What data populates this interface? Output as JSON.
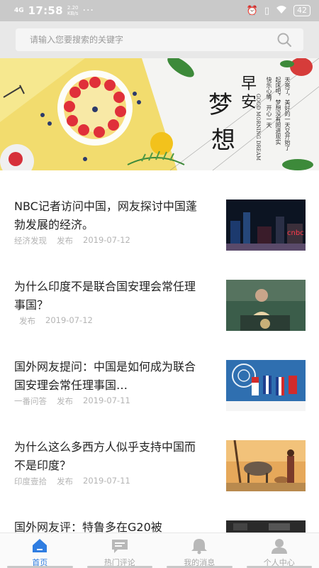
{
  "status_bar": {
    "network": "4G",
    "time": "17:58",
    "speed_value": "2.20",
    "speed_unit": "KB/s",
    "more": "···",
    "battery": "42"
  },
  "search": {
    "placeholder": "请输入您要搜索的关键字"
  },
  "banner": {
    "title_chars": [
      "早",
      "安",
      "梦",
      "想"
    ],
    "english": "GOOD MORNING DREAM",
    "vertical_text": [
      "天亮了，美好的一天又开始了",
      "起床吧，梦想没有照进现实",
      "快乐心情，开心一天"
    ]
  },
  "news": [
    {
      "title": "NBC记者访问中国，网友探讨中国蓬勃发展的经济。",
      "source": "经济发现",
      "publish": "发布",
      "date": "2019-07-12",
      "image": "night-city-photo"
    },
    {
      "title": "为什么印度不是联合国安理会常任理事国？",
      "source": "",
      "publish": "发布",
      "date": "2019-07-12",
      "image": "un-speaker-photo"
    },
    {
      "title": "国外网友提问：中国是如何成为联合国安理会常任理事国…",
      "source": "一番问答",
      "publish": "发布",
      "date": "2019-07-11",
      "image": "un-flags-photo"
    },
    {
      "title": "为什么这么多西方人似乎支持中国而不是印度？",
      "source": "印度壹拾",
      "publish": "发布",
      "date": "2019-07-11",
      "image": "rural-cow-photo"
    },
    {
      "title": "国外网友评：特鲁多在G20被",
      "source": "",
      "publish": "",
      "date": "",
      "image": "summit-photo"
    }
  ],
  "tabs": [
    {
      "label": "首页",
      "icon": "home-icon",
      "active": true
    },
    {
      "label": "热门评论",
      "icon": "comment-icon",
      "active": false
    },
    {
      "label": "我的消息",
      "icon": "bell-icon",
      "active": false
    },
    {
      "label": "个人中心",
      "icon": "user-icon",
      "active": false
    }
  ],
  "colors": {
    "accent": "#2f7de1",
    "status_bar": "#c9c9c9",
    "meta_text": "#b4b4b4"
  }
}
